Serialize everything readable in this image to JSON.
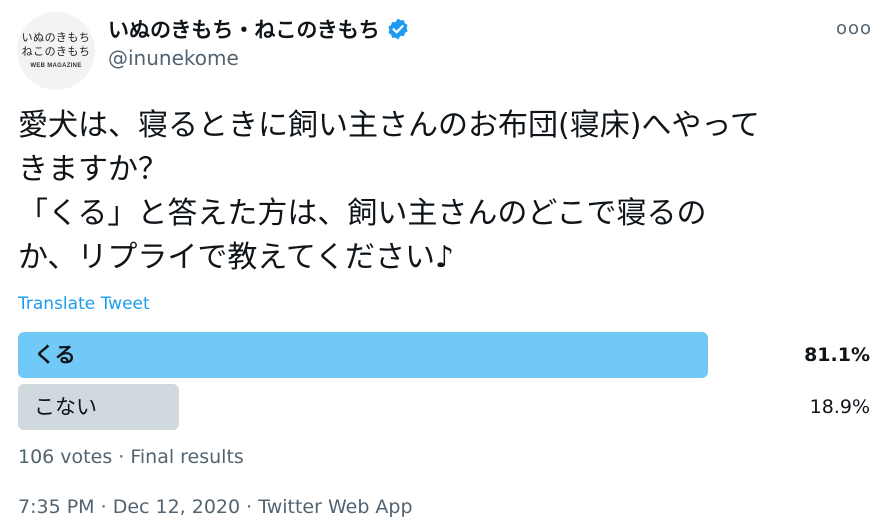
{
  "account": {
    "avatar_line1": "いぬのきもち",
    "avatar_line2": "ねこのきもち",
    "avatar_line3": "WEB MAGAZINE",
    "display_name": "いぬのきもち・ねこのきもち",
    "handle": "@inunekome",
    "verified_icon": "verified-badge-icon",
    "verified_color": "#1d9bf0"
  },
  "more_icon": "more-options-icon",
  "more_glyph": "ooo",
  "tweet": {
    "lines": [
      "愛犬は、寝るときに飼い主さんのお布団(寝床)へやって",
      "きますか？",
      "「くる」と答えた方は、飼い主さんのどこで寝るの",
      "か、リプライで教えてください♪"
    ]
  },
  "translate_label": "Translate Tweet",
  "poll": {
    "options": [
      {
        "label": "くる",
        "percent_text": "81.1%",
        "percent": 81.1,
        "winner": true
      },
      {
        "label": "こない",
        "percent_text": "18.9%",
        "percent": 18.9,
        "winner": false
      }
    ],
    "summary": "106 votes · Final results"
  },
  "meta": {
    "time": "7:35 PM",
    "separator": " · ",
    "date": "Dec 12, 2020",
    "app": "Twitter Web App"
  },
  "colors": {
    "accent": "#1d9bf0",
    "winner_bar": "#71c9f8",
    "loser_bar": "#cfd9de",
    "secondary_text": "#536471"
  }
}
